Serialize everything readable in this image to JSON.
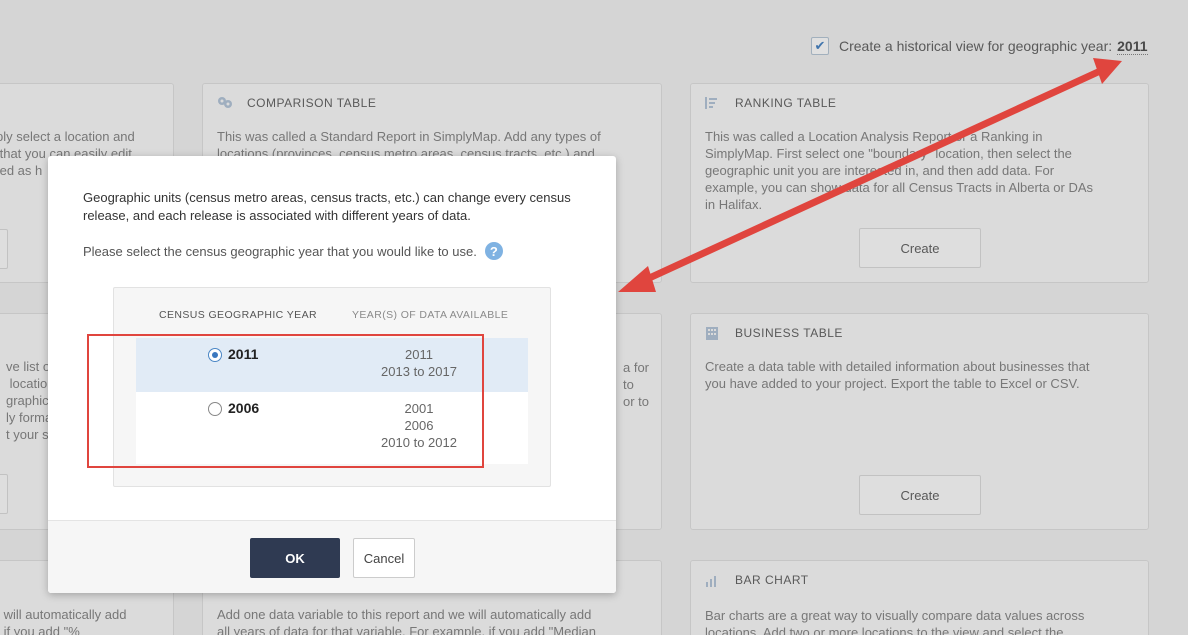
{
  "colors": {
    "accent": "#2f3a52",
    "annotation": "#e0453e",
    "selected_row": "#e1ebf6",
    "help": "#7fb2e2"
  },
  "topbar": {
    "checkbox_checked": true,
    "label": "Create a historical view for geographic year:",
    "year": "2011"
  },
  "cards": {
    "left_top": {
      "desc": "ply select a location and\n that you can easily edit\nted as h"
    },
    "comparison": {
      "icon": "location-pins-icon",
      "title": "COMPARISON TABLE",
      "desc": "This was called a Standard Report in SimplyMap. Add any types of\nlocations (provinces, census metro areas, census tracts, etc.) and\n                                                                     tive."
    },
    "ranking": {
      "icon": "ranking-icon",
      "title": "RANKING TABLE",
      "desc": "This was called a Location Analysis Report or a Ranking in\nSimplyMap. First select one \"boundary\" location, then select the\ngeographic unit you are interested in, and then add data. For\nexample, you can show data for all Census Tracts in Alberta or DAs\nin Halifax.",
      "button": "Create"
    },
    "left_mid": {
      "desc": "ve list o\n location\ngraphic\nly forma\nt your s"
    },
    "middle_mid": {
      "desc": "a for\nto\nor to"
    },
    "business": {
      "icon": "building-icon",
      "title": "BUSINESS TABLE",
      "desc": "Create a data table with detailed information about businesses that\nyou have added to your project. Export the table to Excel or CSV.",
      "button": "Create"
    },
    "left_bottom": {
      "desc": " will automatically add\n if you add \"%"
    },
    "middle_bottom": {
      "desc": "Add one data variable to this report and we will automatically add\nall years of data for that variable. For example, if you add \"Median"
    },
    "bar_chart": {
      "icon": "bar-chart-icon",
      "title": "BAR CHART",
      "desc": "Bar charts are a great way to visually compare data values across\nlocations. Add two or more locations to the view and select the"
    }
  },
  "modal": {
    "intro": "Geographic units (census metro areas, census tracts, etc.) can change every census release, and each release is associated with different years of data.",
    "prompt": "Please select the census geographic year that you would like to use.",
    "help_icon": "question-mark-icon",
    "help_label": "?",
    "table": {
      "col1": "CENSUS GEOGRAPHIC YEAR",
      "col2": "YEAR(S) OF DATA AVAILABLE",
      "rows": [
        {
          "year": "2011",
          "selected": true,
          "available": [
            "2011",
            "2013 to 2017"
          ]
        },
        {
          "year": "2006",
          "selected": false,
          "available": [
            "2001",
            "2006",
            "2010 to 2012"
          ]
        }
      ]
    },
    "ok": "OK",
    "cancel": "Cancel"
  }
}
